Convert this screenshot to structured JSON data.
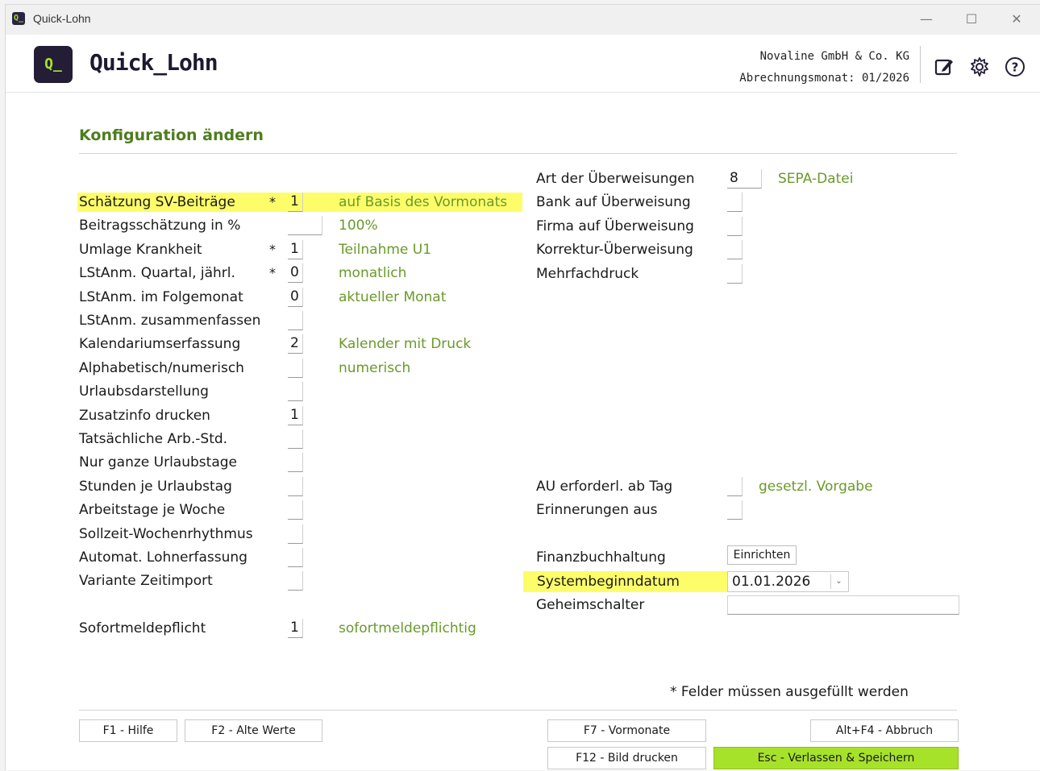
{
  "window": {
    "title": "Quick-Lohn",
    "app_icon": "Q_",
    "controls": {
      "minimize": "—",
      "maximize": "☐",
      "close": "✕"
    }
  },
  "header": {
    "logo": "Q_",
    "app_name": "Quick_Lohn",
    "company": "Novaline GmbH & Co. KG",
    "period_label": "Abrechnungsmonat: 01/2026",
    "icons": [
      "edit-icon",
      "gear-icon",
      "help-icon"
    ]
  },
  "page": {
    "title": "Konfiguration ändern"
  },
  "left_rows": [
    {
      "label": "Schätzung SV-Beiträge",
      "required": "*",
      "value": "1",
      "desc": "auf Basis des Vormonats",
      "highlight": true
    },
    {
      "label": "Beitragsschätzung in %",
      "required": "",
      "value": "",
      "desc": "100%",
      "wide": true
    },
    {
      "label": "Umlage Krankheit",
      "required": "*",
      "value": "1",
      "desc": "Teilnahme U1"
    },
    {
      "label": "LStAnm. Quartal, jährl.",
      "required": "*",
      "value": "0",
      "desc": "monatlich"
    },
    {
      "label": "LStAnm. im Folgemonat",
      "required": "",
      "value": "0",
      "desc": "aktueller Monat"
    },
    {
      "label": "LStAnm. zusammenfassen",
      "required": "",
      "value": "",
      "desc": ""
    },
    {
      "label": "Kalendariumserfassung",
      "required": "",
      "value": "2",
      "desc": "Kalender mit Druck"
    },
    {
      "label": "Alphabetisch/numerisch",
      "required": "",
      "value": "",
      "desc": "numerisch"
    },
    {
      "label": "Urlaubsdarstellung",
      "required": "",
      "value": "",
      "desc": ""
    },
    {
      "label": "Zusatzinfo drucken",
      "required": "",
      "value": "1",
      "desc": ""
    },
    {
      "label": "Tatsächliche Arb.-Std.",
      "required": "",
      "value": "",
      "desc": ""
    },
    {
      "label": "Nur ganze Urlaubstage",
      "required": "",
      "value": "",
      "desc": ""
    },
    {
      "label": "Stunden je Urlaubstag",
      "required": "",
      "value": "",
      "desc": ""
    },
    {
      "label": "Arbeitstage je Woche",
      "required": "",
      "value": "",
      "desc": ""
    },
    {
      "label": "Sollzeit-Wochenrhythmus",
      "required": "",
      "value": "",
      "desc": ""
    },
    {
      "label": "Automat. Lohnerfassung",
      "required": "",
      "value": "",
      "desc": ""
    },
    {
      "label": "Variante Zeitimport",
      "required": "",
      "value": "",
      "desc": ""
    }
  ],
  "sofort": {
    "label": "Sofortmeldepflicht",
    "value": "1",
    "desc": "sofortmeldepflichtig"
  },
  "right_top": [
    {
      "label": "Art der Überweisungen",
      "value": "8",
      "desc": "SEPA-Datei",
      "wide": true
    },
    {
      "label": "Bank  auf Überweisung",
      "value": "",
      "desc": ""
    },
    {
      "label": "Firma auf Überweisung",
      "value": "",
      "desc": ""
    },
    {
      "label": "Korrektur-Überweisung",
      "value": "",
      "desc": ""
    },
    {
      "label": "Mehrfachdruck",
      "value": "",
      "desc": ""
    }
  ],
  "right_mid": [
    {
      "label": "AU erforderl. ab Tag",
      "value": "",
      "desc": "gesetzl. Vorgabe"
    },
    {
      "label": "Erinnerungen aus",
      "value": "",
      "desc": ""
    }
  ],
  "finanz": {
    "label": "Finanzbuchhaltung",
    "button": "Einrichten"
  },
  "system": {
    "label": "Systembeginndatum",
    "value": "01.01.2026",
    "arrow": "⌄"
  },
  "secret": {
    "label": "Geheimschalter",
    "value": ""
  },
  "required_note": "*  Felder müssen ausgefüllt werden",
  "buttons": {
    "help": "F1 - Hilfe",
    "old_values": "F2 - Alte Werte",
    "prev_months": "F7 - Vormonate",
    "print": "F12 - Bild drucken",
    "cancel": "Alt+F4 - Abbruch",
    "save_exit": "Esc - Verlassen & Speichern"
  },
  "colors": {
    "accent_green": "#a7e22a",
    "desc_green": "#6a9a2a",
    "title_green": "#4e7d1e",
    "highlight": "#fdfd6a",
    "logo_dark": "#241d36"
  }
}
